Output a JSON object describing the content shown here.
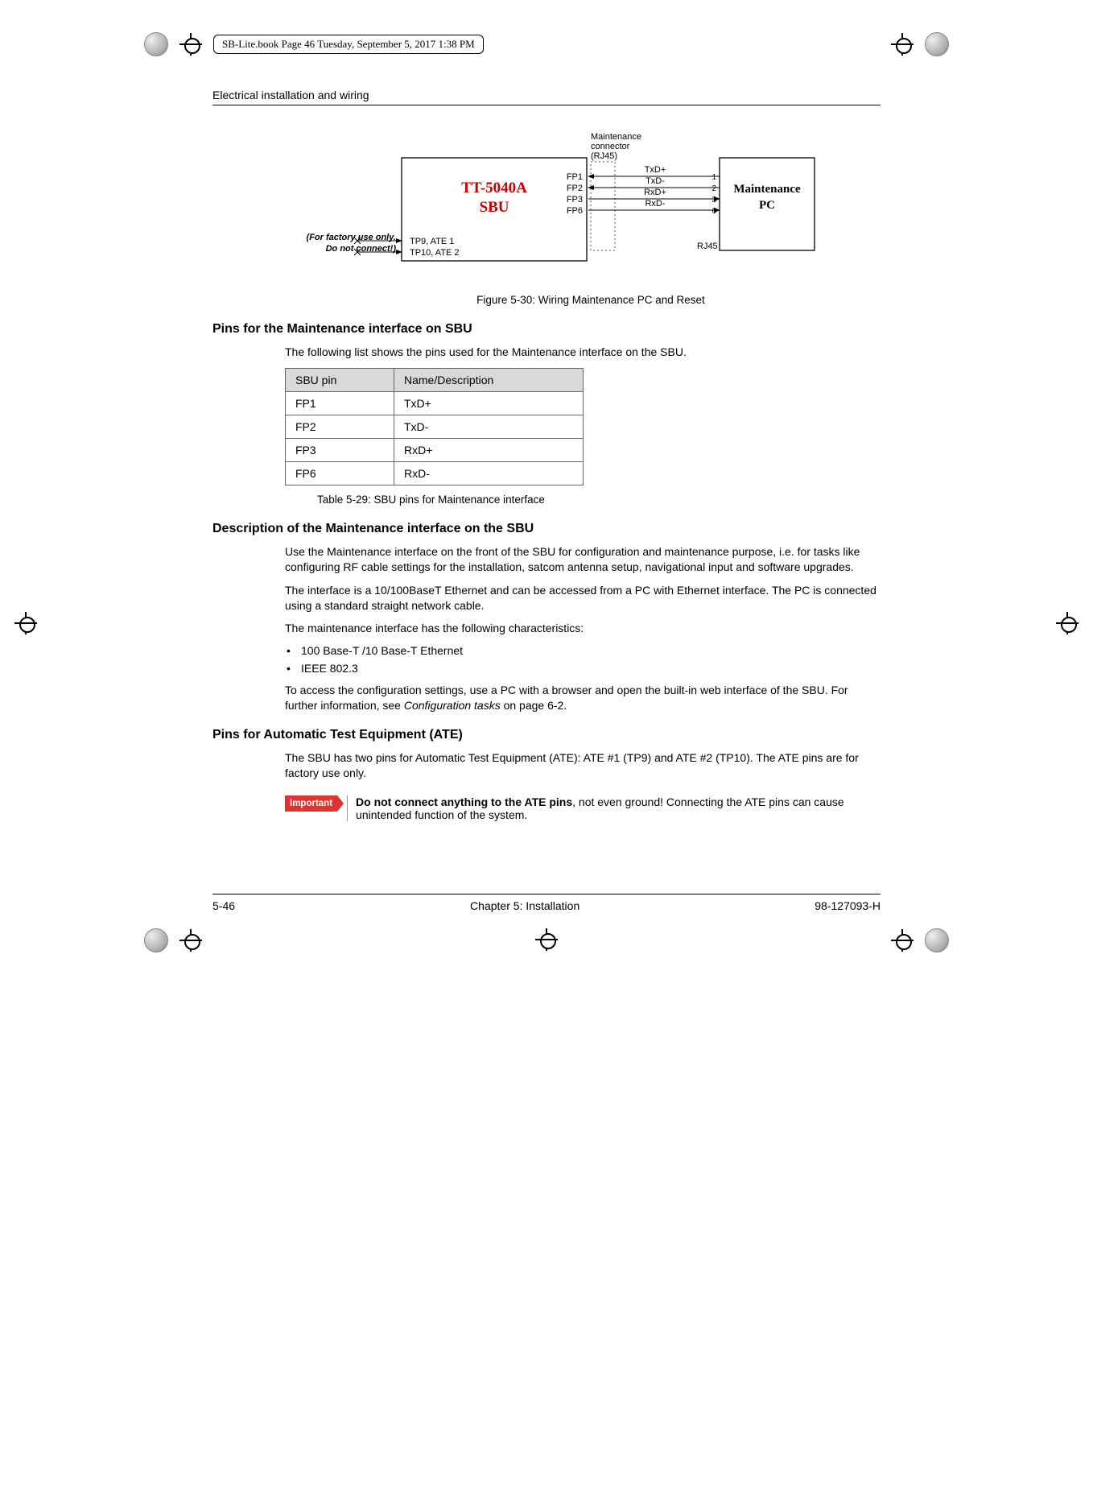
{
  "file_stamp": "SB-Lite.book  Page 46  Tuesday, September 5, 2017  1:38 PM",
  "running_head": "Electrical installation and wiring",
  "diagram": {
    "sbu_title_line1": "TT-5040A",
    "sbu_title_line2": "SBU",
    "left_note_line1": "(For factory use only.",
    "left_note_line2": "Do not connect!)",
    "tp9": "TP9, ATE 1",
    "tp10": "TP10, ATE 2",
    "fp1": "FP1",
    "fp2": "FP2",
    "fp3": "FP3",
    "fp6": "FP6",
    "maint_l1": "Maintenance",
    "maint_l2": "connector",
    "maint_l3": "(RJ45)",
    "sig1": "TxD+",
    "sig2": "TxD-",
    "sig3": "RxD+",
    "sig4": "RxD-",
    "p1": "1",
    "p2": "2",
    "p3": "3",
    "p6": "6",
    "rj45": "RJ45",
    "pc_l1": "Maintenance",
    "pc_l2": "PC"
  },
  "figure_caption": "Figure 5-30: Wiring Maintenance PC and Reset",
  "h_pins_sbu": "Pins for the Maintenance interface on SBU",
  "p_pins_intro": "The following list shows the pins used for the Maintenance interface on the SBU.",
  "table": {
    "h1": "SBU pin",
    "h2": "Name/Description",
    "rows": [
      {
        "c1": "FP1",
        "c2": "TxD+"
      },
      {
        "c1": "FP2",
        "c2": "TxD-"
      },
      {
        "c1": "FP3",
        "c2": "RxD+"
      },
      {
        "c1": "FP6",
        "c2": "RxD-"
      }
    ]
  },
  "table_caption": "Table 5-29: SBU pins for Maintenance interface",
  "h_desc": "Description of the Maintenance interface on the SBU",
  "p_desc_1": "Use the Maintenance interface on the front of the SBU for configuration and maintenance purpose, i.e. for tasks like configuring RF cable settings for the installation, satcom antenna setup, navigational input and software upgrades.",
  "p_desc_2": "The interface is a 10/100BaseT Ethernet and can be accessed from a PC with Ethernet interface. The PC is connected using a standard straight network cable.",
  "p_desc_3": "The maintenance interface has the following characteristics:",
  "bullets": {
    "b1": "100 Base-T /10 Base-T Ethernet",
    "b2": "IEEE 802.3"
  },
  "p_desc_4a": "To access the configuration settings, use a PC with a browser and open the built-in web interface of the SBU. For further information, see ",
  "p_desc_4b": "Configuration tasks",
  "p_desc_4c": " on page 6-2.",
  "h_ate": "Pins for Automatic Test Equipment (ATE)",
  "p_ate": "The SBU has two pins for Automatic Test Equipment (ATE): ATE #1 (TP9) and ATE #2 (TP10). The ATE pins are for factory use only.",
  "important_label": "Important",
  "important_bold": "Do not connect anything to the ATE pins",
  "important_rest": ", not even ground! Connecting the ATE pins can cause unintended function of the system.",
  "footer_left": "5-46",
  "footer_center": "Chapter 5:  Installation",
  "footer_right": "98-127093-H"
}
